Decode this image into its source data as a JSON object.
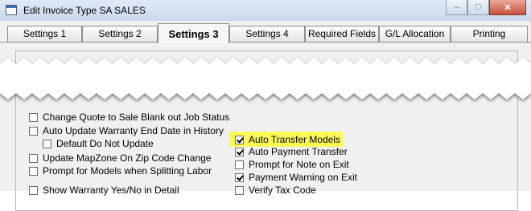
{
  "window": {
    "title": "Edit Invoice Type  SA SALES",
    "minimize": "–",
    "maximize": "□",
    "close": "✕"
  },
  "tabs": [
    {
      "label": "Settings 1"
    },
    {
      "label": "Settings 2"
    },
    {
      "label": "Settings 3",
      "active": true
    },
    {
      "label": "Settings 4"
    },
    {
      "label": "Required Fields"
    },
    {
      "label": "G/L Allocation"
    },
    {
      "label": "Printing"
    }
  ],
  "left_options": [
    {
      "label": "Change Quote to Sale   Blank out Job Status",
      "checked": false
    },
    {
      "label": "Auto Update Warranty End Date in History",
      "checked": false
    },
    {
      "label": "Default Do Not Update",
      "checked": false
    },
    {
      "label": "Update MapZone On Zip Code Change",
      "checked": false
    },
    {
      "label": "Prompt for Models when Splitting Labor",
      "checked": false
    },
    {
      "label": "Show Warranty Yes/No in Detail",
      "checked": false
    }
  ],
  "right_options": [
    {
      "label": "Auto Transfer Models",
      "checked": true,
      "highlighted": true
    },
    {
      "label": "Auto Payment Transfer",
      "checked": true
    },
    {
      "label": "Prompt for Note on Exit",
      "checked": false
    },
    {
      "label": "Payment Warning on Exit",
      "checked": true
    },
    {
      "label": "Verify Tax Code",
      "checked": false
    }
  ],
  "colors": {
    "highlight": "#fbfb57",
    "panel": "#f0f0f0"
  }
}
